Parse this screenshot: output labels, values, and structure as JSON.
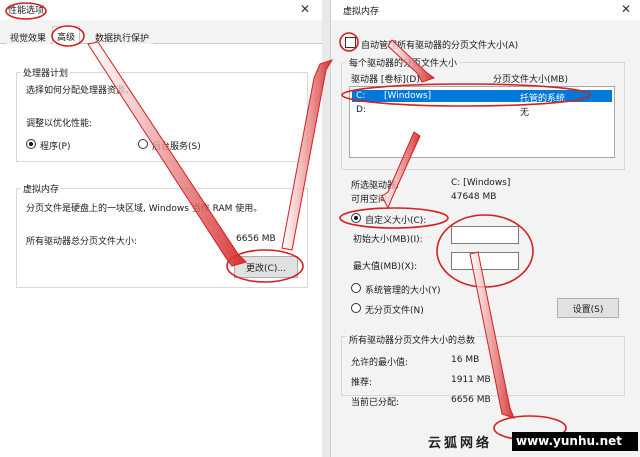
{
  "left_dialog": {
    "title": "性能选项",
    "tabs": [
      {
        "label": "视觉效果"
      },
      {
        "label": "高级"
      },
      {
        "label": "数据执行保护"
      }
    ],
    "processor": {
      "group_title": "处理器计划",
      "description": "选择如何分配处理器资源。",
      "adjust_label": "调整以优化性能:",
      "options": [
        "程序(P)",
        "后台服务(S)"
      ]
    },
    "virtual_memory": {
      "group_title": "虚拟内存",
      "description": "分页文件是硬盘上的一块区域, Windows 当作 RAM 使用。",
      "total_label": "所有驱动器总分页文件大小:",
      "total_value": "6656 MB",
      "change_button": "更改(C)..."
    }
  },
  "right_dialog": {
    "title": "虚拟内存",
    "auto_manage_label": "自动管理所有驱动器的分页文件大小(A)",
    "per_drive_group": "每个驱动器的分页文件大小",
    "columns": [
      "驱动器 [卷标](D)",
      "分页文件大小(MB)"
    ],
    "drives": [
      {
        "drive": "C:",
        "label": "[Windows]",
        "size": "托管的系统"
      },
      {
        "drive": "D:",
        "label": "",
        "size": "无"
      }
    ],
    "selected_drive_label": "所选驱动器:",
    "selected_drive_value": "C:  [Windows]",
    "free_space_label": "可用空间:",
    "free_space_value": "47648 MB",
    "custom_size_label": "自定义大小(C):",
    "initial_size_label": "初始大小(MB)(I):",
    "max_size_label": "最大值(MB)(X):",
    "system_managed_label": "系统管理的大小(Y)",
    "no_paging_label": "无分页文件(N)",
    "set_button": "设置(S)",
    "total_group": "所有驱动器分页文件大小的总数",
    "min_allowed_label": "允许的最小值:",
    "min_allowed_value": "16 MB",
    "recommended_label": "推荐:",
    "recommended_value": "1911 MB",
    "current_label": "当前已分配:",
    "current_value": "6656 MB"
  },
  "watermark": {
    "site_name": "云狐网络",
    "url": "www.yunhu.net"
  },
  "colors": {
    "annotation": "#d32020",
    "selection": "#0078d7",
    "watermark_bg": "#000000"
  }
}
